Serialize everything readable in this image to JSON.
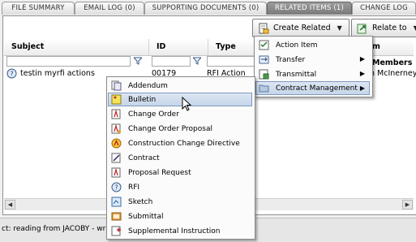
{
  "tabs": [
    {
      "label": "FILE SUMMARY",
      "active": false
    },
    {
      "label": "EMAIL LOG (0)",
      "active": false
    },
    {
      "label": "SUPPORTING DOCUMENTS (0)",
      "active": false
    },
    {
      "label": "RELATED ITEMS (1)",
      "active": true
    },
    {
      "label": "CHANGE LOG",
      "active": false
    }
  ],
  "toolbar": {
    "create_related_label": "Create Related",
    "relate_to_label": "Relate to"
  },
  "grid": {
    "columns": [
      {
        "label": "Subject"
      },
      {
        "label": "ID"
      },
      {
        "label": "Type"
      },
      {
        "label": "m Members"
      }
    ],
    "rows": [
      {
        "subject": "testin myrfi actions",
        "id": "00179",
        "type": "RFI Action",
        "member": "n McInerney"
      }
    ]
  },
  "create_menu": {
    "items": [
      {
        "label": "Action Item",
        "icon": "action-item-icon",
        "submenu": false
      },
      {
        "label": "Transfer",
        "icon": "transfer-icon",
        "submenu": true
      },
      {
        "label": "Transmittal",
        "icon": "transmittal-icon",
        "submenu": true
      },
      {
        "label": "Contract Management",
        "icon": "folder-icon",
        "submenu": true,
        "highlighted": true
      }
    ]
  },
  "contract_menu": {
    "items": [
      {
        "label": "Addendum",
        "icon": "addendum-icon"
      },
      {
        "label": "Bulletin",
        "icon": "bulletin-icon",
        "highlighted": true
      },
      {
        "label": "Change Order",
        "icon": "change-order-icon"
      },
      {
        "label": "Change Order Proposal",
        "icon": "change-order-proposal-icon"
      },
      {
        "label": "Construction Change Directive",
        "icon": "ccd-icon"
      },
      {
        "label": "Contract",
        "icon": "contract-icon"
      },
      {
        "label": "Proposal Request",
        "icon": "proposal-request-icon"
      },
      {
        "label": "RFI",
        "icon": "rfi-icon"
      },
      {
        "label": "Sketch",
        "icon": "sketch-icon"
      },
      {
        "label": "Submittal",
        "icon": "submittal-icon"
      },
      {
        "label": "Supplemental Instruction",
        "icon": "supplemental-instruction-icon"
      }
    ]
  },
  "status_text": "ct: reading from JACOBY - writing to"
}
